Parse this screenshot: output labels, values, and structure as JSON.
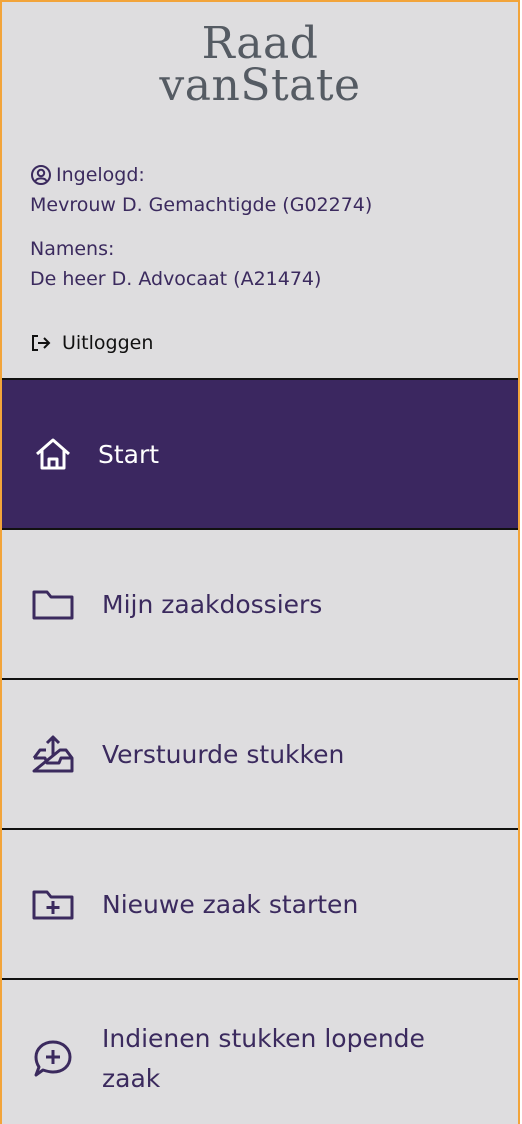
{
  "logo": {
    "line1": "Raad",
    "line2": "vanState"
  },
  "user": {
    "logged_in_label": "Ingelogd:",
    "logged_in_name": "Mevrouw D. Gemachtigde (G02274)",
    "on_behalf_label": "Namens:",
    "on_behalf_name": "De heer D. Advocaat (A21474)",
    "logout_label": "Uitloggen"
  },
  "nav": {
    "items": [
      {
        "label": "Start",
        "icon": "home-icon",
        "active": true
      },
      {
        "label": "Mijn zaakdossiers",
        "icon": "folder-icon"
      },
      {
        "label": "Verstuurde stukken",
        "icon": "upload-tray-icon"
      },
      {
        "label": "Nieuwe zaak starten",
        "icon": "folder-plus-icon"
      },
      {
        "label": "Indienen stukken lopende zaak",
        "icon": "chat-plus-icon"
      }
    ]
  },
  "colors": {
    "accent_purple": "#3b2760",
    "text_purple": "#3b2a5e",
    "sidebar_bg": "#dedddf",
    "border_orange": "#f2a43a"
  }
}
